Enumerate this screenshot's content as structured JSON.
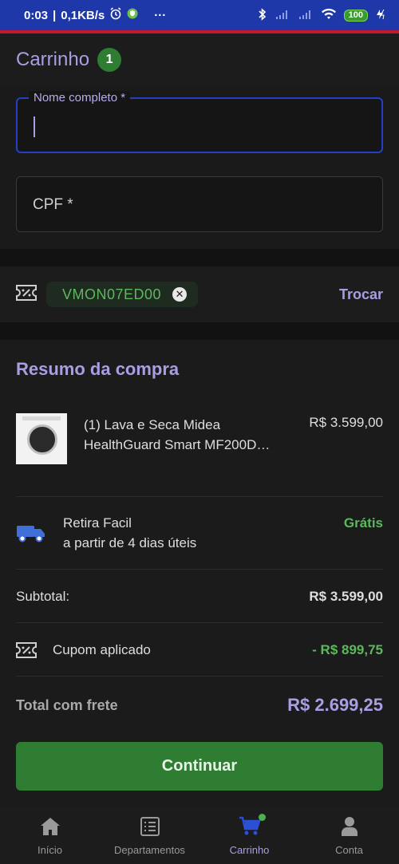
{
  "status_bar": {
    "time": "0:03",
    "net_speed": "0,1KB/s",
    "more": "···",
    "battery": "100"
  },
  "header": {
    "title": "Carrinho",
    "badge_count": "1"
  },
  "form": {
    "name_label": "Nome completo *",
    "name_value": "",
    "cpf_placeholder": "CPF *"
  },
  "coupon": {
    "code": "VMON07ED00",
    "remove_icon": "close-circle-icon",
    "change_label": "Trocar"
  },
  "summary": {
    "title": "Resumo da compra",
    "product": {
      "name": "(1) Lava e Seca Midea HealthGuard Smart MF200D…",
      "price": "R$ 3.599,00",
      "image_icon": "washing-machine"
    },
    "shipping": {
      "method": "Retira Facil",
      "eta": "a partir de 4 dias úteis",
      "price": "Grátis"
    },
    "subtotal_label": "Subtotal:",
    "subtotal_value": "R$ 3.599,00",
    "coupon_label": "Cupom aplicado",
    "coupon_value": "- R$ 899,75",
    "total_label": "Total com frete",
    "total_value": "R$ 2.699,25"
  },
  "continue_button": "Continuar",
  "nav": {
    "items": [
      {
        "label": "Início",
        "icon": "home-icon"
      },
      {
        "label": "Departamentos",
        "icon": "list-icon"
      },
      {
        "label": "Carrinho",
        "icon": "cart-icon"
      },
      {
        "label": "Conta",
        "icon": "user-icon"
      }
    ],
    "active": "Carrinho"
  },
  "colors": {
    "accent": "#a79fe3",
    "green": "#2e7d32",
    "status_bar": "#1f38a9",
    "background": "#121212"
  }
}
